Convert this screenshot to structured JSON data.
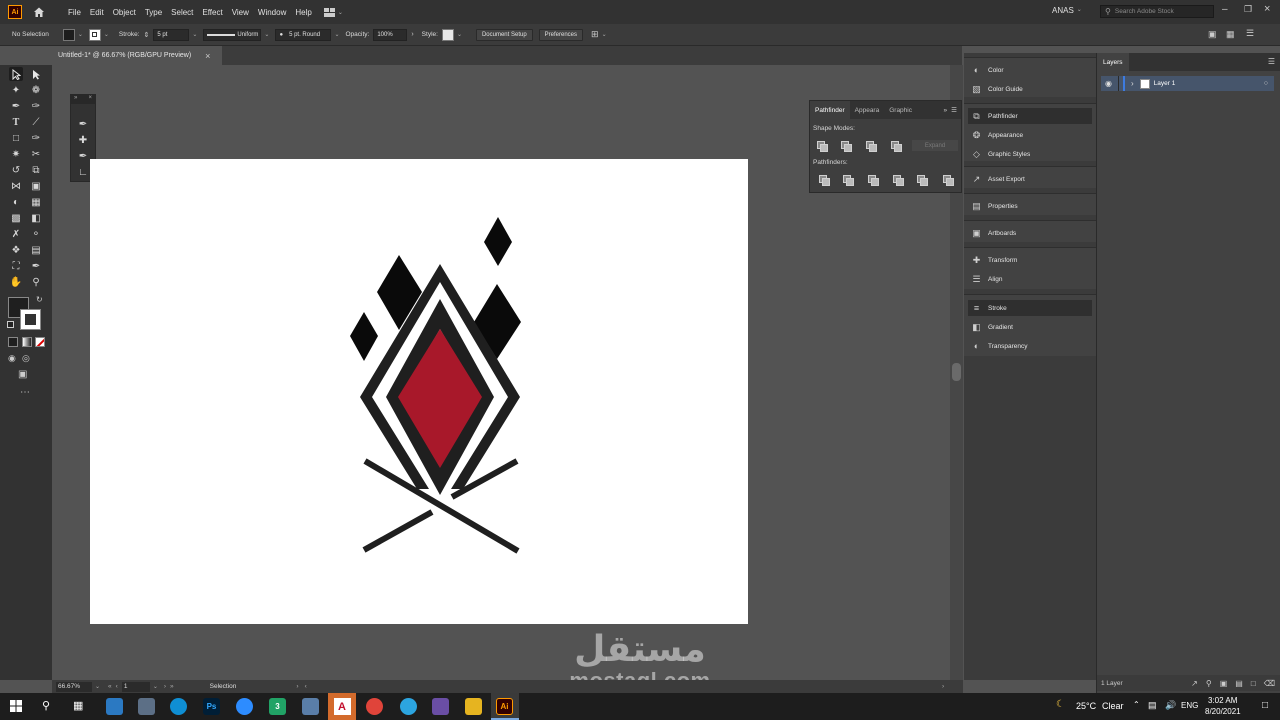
{
  "app": {
    "logo": "Ai",
    "menus": [
      "File",
      "Edit",
      "Object",
      "Type",
      "Select",
      "Effect",
      "View",
      "Window",
      "Help"
    ],
    "user": "ANAS",
    "search_placeholder": "Search Adobe Stock"
  },
  "control_bar": {
    "selection": "No Selection",
    "stroke_label": "Stroke:",
    "stroke_value": "5 pt",
    "profile": "Uniform",
    "brush": "5 pt. Round",
    "opacity_label": "Opacity:",
    "opacity_value": "100%",
    "style_label": "Style:",
    "document_setup": "Document Setup",
    "preferences": "Preferences"
  },
  "document": {
    "tab_title": "Untitled-1* @ 66.67% (RGB/GPU Preview)",
    "close": "×"
  },
  "status_bar": {
    "zoom": "66.67%",
    "artboard": "1",
    "tool": "Selection"
  },
  "pathfinder": {
    "tabs": [
      "Pathfinder",
      "Appeara",
      "Graphic"
    ],
    "shape_modes_label": "Shape Modes:",
    "expand_label": "Expand",
    "pathfinders_label": "Pathfinders:"
  },
  "dock": {
    "items": [
      {
        "label": "Color",
        "icon": "color-icon"
      },
      {
        "label": "Color Guide",
        "icon": "color-guide-icon"
      },
      {
        "label": "Pathfinder",
        "icon": "pathfinder-icon"
      },
      {
        "label": "Appearance",
        "icon": "appearance-icon"
      },
      {
        "label": "Graphic Styles",
        "icon": "graphic-styles-icon"
      },
      {
        "label": "Asset Export",
        "icon": "asset-export-icon"
      },
      {
        "label": "Properties",
        "icon": "properties-icon"
      },
      {
        "label": "Artboards",
        "icon": "artboards-icon"
      },
      {
        "label": "Transform",
        "icon": "transform-icon"
      },
      {
        "label": "Align",
        "icon": "align-icon"
      },
      {
        "label": "Stroke",
        "icon": "stroke-icon"
      },
      {
        "label": "Gradient",
        "icon": "gradient-icon"
      },
      {
        "label": "Transparency",
        "icon": "transparency-icon"
      }
    ]
  },
  "layers": {
    "tab": "Layers",
    "layer_name": "Layer 1",
    "count": "1 Layer"
  },
  "artwork": {
    "accent": "#a8182a",
    "ink": "#1a1a1a"
  },
  "watermark": {
    "arabic": "مستقل",
    "latin": "mostaql.com"
  },
  "taskbar": {
    "temperature": "25°C",
    "weather": "Clear",
    "language": "ENG",
    "time": "3:02 AM",
    "date": "8/20/2021"
  }
}
